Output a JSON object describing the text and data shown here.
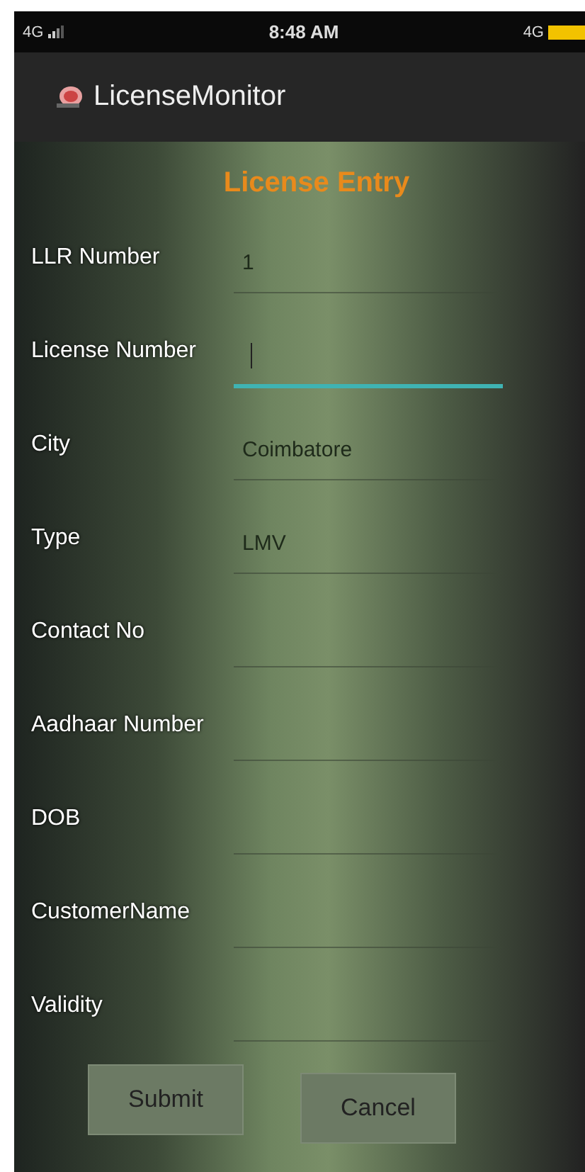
{
  "status_bar": {
    "network": "4G",
    "time": "8:48 AM",
    "network_right": "4G"
  },
  "app_bar": {
    "title": "LicenseMonitor"
  },
  "form": {
    "title": "License Entry",
    "fields": [
      {
        "label": "LLR Number",
        "value": "1",
        "focused": false
      },
      {
        "label": "License Number",
        "focused": true
      },
      {
        "label": "City",
        "value": "Coimbatore",
        "focused": false
      },
      {
        "label": "Type",
        "value": "LMV",
        "focused": false
      },
      {
        "label": "Contact No",
        "focused": false
      },
      {
        "label": "Aadhaar Number",
        "focused": false
      },
      {
        "label": "DOB",
        "focused": false
      },
      {
        "label": "CustomerName",
        "focused": false
      },
      {
        "label": "Validity",
        "focused": false
      }
    ],
    "buttons": [
      "Submit",
      "Cancel"
    ]
  }
}
